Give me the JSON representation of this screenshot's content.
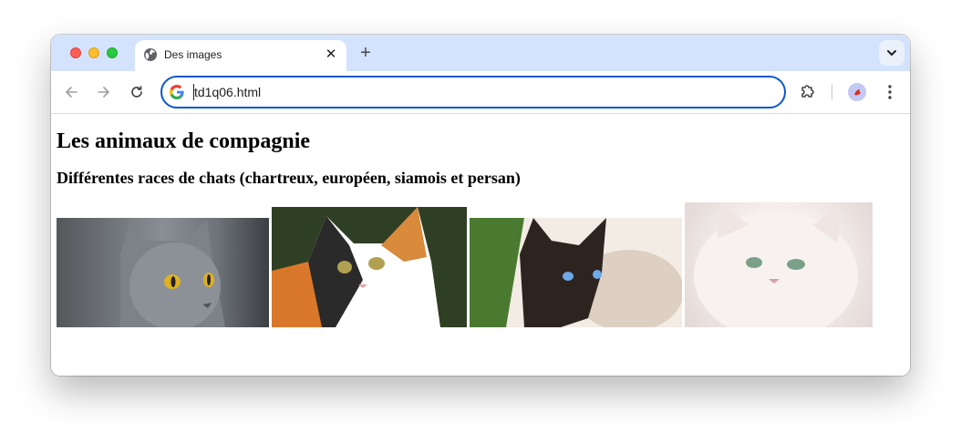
{
  "browser": {
    "tab_title": "Des images",
    "tab_close": "✕",
    "new_tab": "+",
    "url": "td1q06.html",
    "accent_color": "#0b57d0",
    "tabstrip_color": "#d3e3fd"
  },
  "page": {
    "heading": "Les animaux de compagnie",
    "subheading": "Différentes races de chats (chartreux, européen, siamois et persan)"
  },
  "icons": {
    "tab_favicon": "globe-icon",
    "back": "arrow-left-icon",
    "forward": "arrow-right-icon",
    "reload": "reload-icon",
    "search_engine": "google-icon",
    "extensions": "puzzle-icon",
    "profile": "avatar-icon",
    "menu": "more-vertical-icon",
    "tab_search": "chevron-down-icon"
  }
}
